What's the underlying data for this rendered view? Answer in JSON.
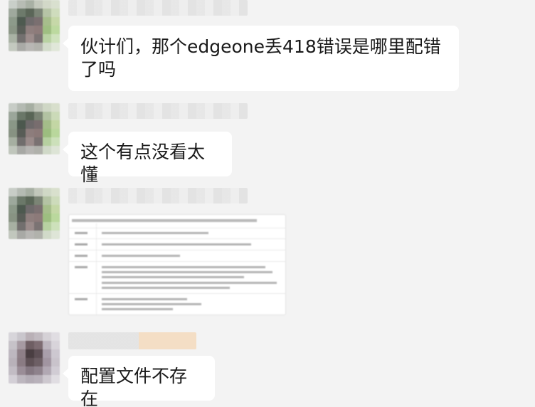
{
  "messages": [
    {
      "text": "伙计们，那个edgeone丢418错误是哪里配错了吗"
    },
    {
      "text": "这个有点没看太懂"
    },
    {
      "type": "image"
    },
    {
      "text": "配置文件不存在"
    }
  ]
}
